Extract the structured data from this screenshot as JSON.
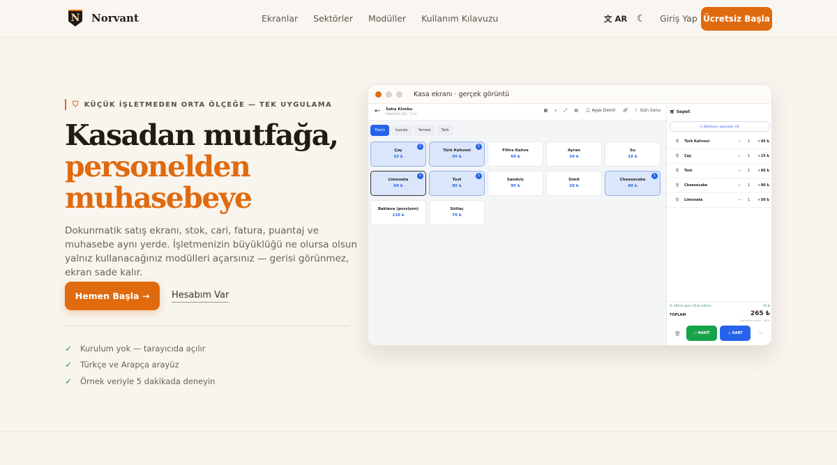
{
  "nav": {
    "brand": "Norvant",
    "logo_letter": "N",
    "items": [
      "Ekranlar",
      "Sektörler",
      "Modüller",
      "Kullanım Kılavuzu"
    ],
    "lang": "AR",
    "login": "Giriş Yap",
    "cta": "Ücretsiz Başla"
  },
  "hero": {
    "eyebrow": "KÜÇÜK İŞLETMEDEN ORTA ÖLÇEĞE — TEK UYGULAMA",
    "title_line1": "Kasadan mutfağa,",
    "title_accent1": "personelden",
    "title_accent2": "muhasebeye",
    "description": "Dokunmatik satış ekranı, stok, cari, fatura, puantaj ve muhasebe aynı yerde. İşletmenizin büyüklüğü ne olursa olsun yalnız kullanacağınız modülleri açarsınız — gerisi görünmez, ekran sade kalır.",
    "primary_button": "Hemen Başla →",
    "secondary_button": "Hesabım Var",
    "checks": [
      "Kurulum yok — tarayıcıda açılır",
      "Türkçe ve Arapça arayüz",
      "Örnek veriyle 5 dakikada deneyin"
    ]
  },
  "preview": {
    "window_title": "Kasa ekranı · gerçek görüntü",
    "pos_title": "Satış Kiosku",
    "pos_subtitle": "PSK-0039 SPC · 3 hl",
    "user": "Ayşe Demir",
    "day_end": "Gün Sonu",
    "categories": [
      "Tümü",
      "İçecek",
      "Yemek",
      "Tatlı"
    ],
    "products": [
      {
        "name": "Çay",
        "price": "15 ₺",
        "badge": "1"
      },
      {
        "name": "Türk Kahvesi",
        "price": "45 ₺",
        "badge": "1"
      },
      {
        "name": "Filtre Kahve",
        "price": "60 ₺",
        "badge": ""
      },
      {
        "name": "Ayran",
        "price": "20 ₺",
        "badge": ""
      },
      {
        "name": "Su",
        "price": "10 ₺",
        "badge": ""
      },
      {
        "name": "Limonata",
        "price": "50 ₺",
        "badge": "1"
      },
      {
        "name": "Tost",
        "price": "85 ₺",
        "badge": "1"
      },
      {
        "name": "Sandviç",
        "price": "95 ₺",
        "badge": ""
      },
      {
        "name": "Simit",
        "price": "20 ₺",
        "badge": ""
      },
      {
        "name": "Cheesecake",
        "price": "90 ₺",
        "badge": "1"
      },
      {
        "name": "Baklava (porsiyon)",
        "price": "110 ₺",
        "badge": ""
      },
      {
        "name": "Sütlaç",
        "price": "70 ₺",
        "badge": ""
      }
    ],
    "cart_title": "Sepet",
    "pending": "Bekleyen siparişler (4)",
    "cart_items": [
      {
        "name": "Türk Kahvesi",
        "qty": "1",
        "price": "45 ₺"
      },
      {
        "name": "Çay",
        "qty": "1",
        "price": "15 ₺"
      },
      {
        "name": "Tost",
        "qty": "1",
        "price": "85 ₺"
      },
      {
        "name": "Cheesecake",
        "qty": "1",
        "price": "90 ₺"
      },
      {
        "name": "Limonata",
        "qty": "1",
        "price": "50 ₺"
      }
    ],
    "saving": "% 200 ₺ üzeri 15 ₺ indirim",
    "saving_amount": "-15 ₺",
    "total_label": "TOPLAM",
    "total": "265 ₺",
    "total_note": "indirimden sonra · 280 ₺",
    "cash": "NAKİT",
    "card": "KART"
  },
  "colors": {
    "accent": "#e06a0e",
    "pos_blue": "#2563eb",
    "pos_green": "#16a34a",
    "background": "#f8f4ee"
  }
}
